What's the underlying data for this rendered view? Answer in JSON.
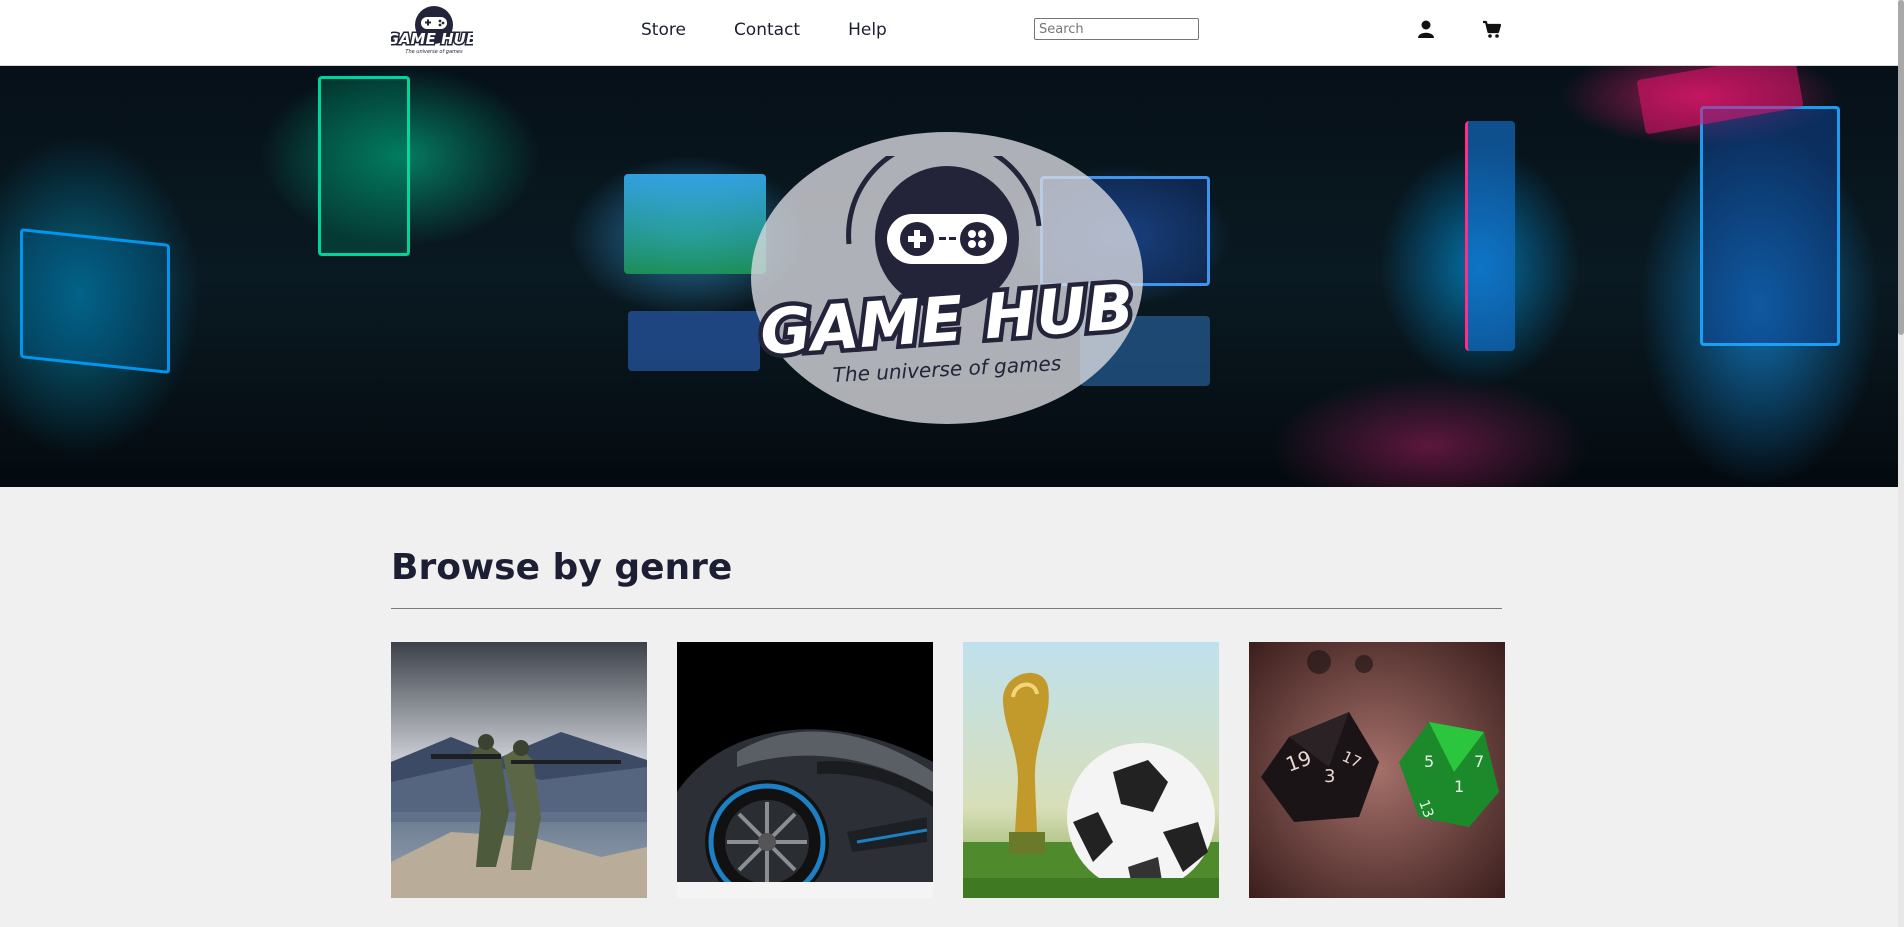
{
  "header": {
    "logo": {
      "name": "GAME HUB",
      "tagline": "The universe of games"
    },
    "nav": [
      {
        "label": "Store"
      },
      {
        "label": "Contact"
      },
      {
        "label": "Help"
      }
    ],
    "search": {
      "placeholder": "Search",
      "value": ""
    },
    "icons": [
      "user-icon",
      "cart-icon"
    ]
  },
  "hero": {
    "logo_title": "GAME HUB",
    "logo_tagline": "The universe of games"
  },
  "genres": {
    "title": "Browse by genre",
    "cards": [
      {
        "image": "soldiers-shooter"
      },
      {
        "image": "sports-car-racing"
      },
      {
        "image": "world-cup-football"
      },
      {
        "image": "dice-tabletop"
      }
    ]
  }
}
